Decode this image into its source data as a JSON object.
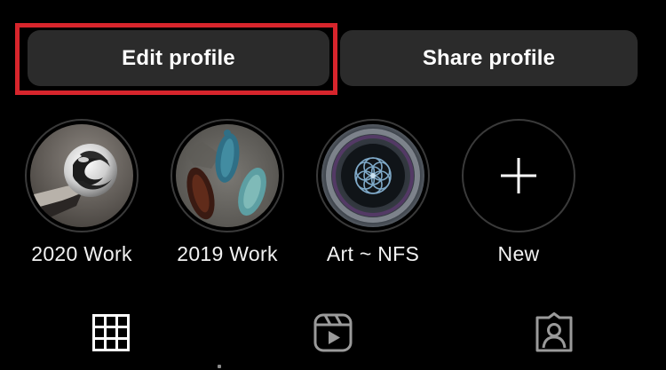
{
  "profile_actions": {
    "edit_label": "Edit profile",
    "share_label": "Share profile",
    "highlight_color": "#d7252c"
  },
  "highlights": [
    {
      "label": "2020 Work",
      "icon": "glass-marble-thumbnail"
    },
    {
      "label": "2019 Work",
      "icon": "glass-leaves-thumbnail"
    },
    {
      "label": "Art ~ NFS",
      "icon": "flower-of-life-thumbnail"
    },
    {
      "label": "New",
      "icon": "plus-icon"
    }
  ],
  "tabs": [
    {
      "name": "posts",
      "icon": "grid-icon",
      "active": true
    },
    {
      "name": "reels",
      "icon": "reels-icon",
      "active": false
    },
    {
      "name": "tagged",
      "icon": "tagged-person-icon",
      "active": false
    }
  ],
  "colors": {
    "background": "#000000",
    "button_bg": "#2b2b2b",
    "text": "#ffffff"
  }
}
